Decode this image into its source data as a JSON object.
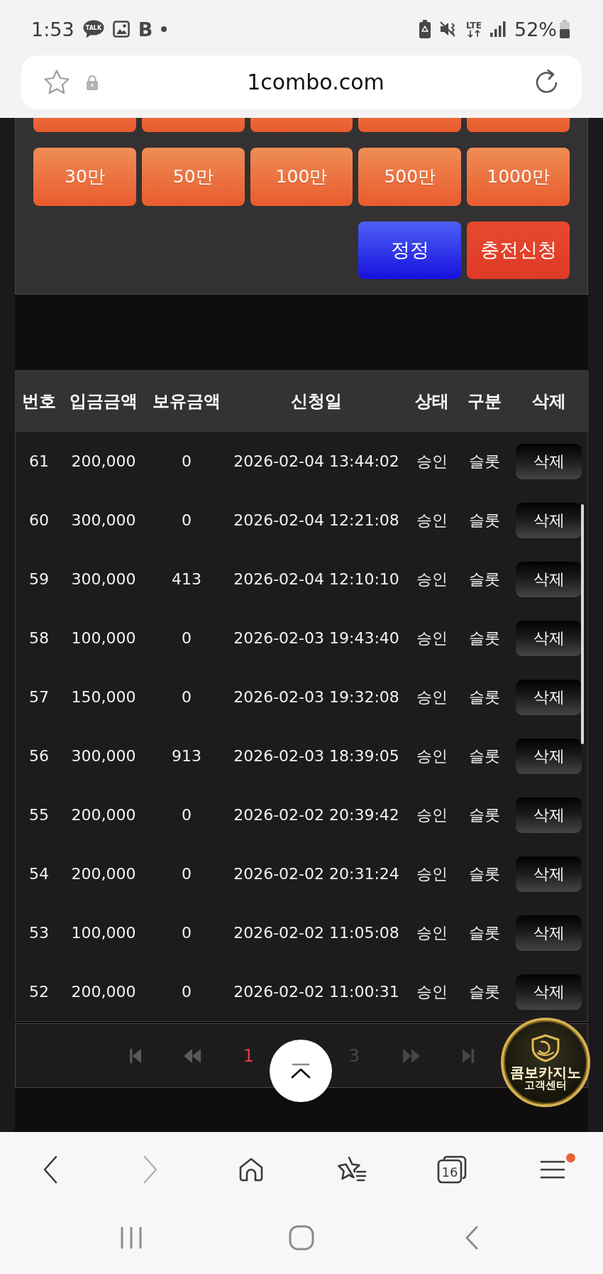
{
  "status_bar": {
    "time": "1:53",
    "notifications": [
      {
        "kind": "talk",
        "label": "TALK"
      },
      {
        "kind": "image"
      },
      {
        "kind": "letter",
        "label": "B"
      },
      {
        "kind": "dot"
      }
    ],
    "network": "LTE",
    "battery": "52%"
  },
  "address_bar": {
    "url": "1combo.com"
  },
  "amount_rows": [
    {
      "buttons": [
        {
          "clipped": true
        },
        {
          "clipped": true
        },
        {
          "clipped": true
        },
        {
          "clipped": true
        },
        {
          "clipped": true
        }
      ]
    },
    {
      "buttons": [
        {
          "label": "30만",
          "clipped": false
        },
        {
          "label": "50만",
          "clipped": false
        },
        {
          "label": "100만",
          "clipped": false
        },
        {
          "label": "500만",
          "clipped": false
        },
        {
          "label": "1000만",
          "clipped": false
        }
      ]
    }
  ],
  "actions": [
    {
      "kind": "correct",
      "label": "정정"
    },
    {
      "kind": "submit",
      "label": "충전신청"
    }
  ],
  "table": {
    "columns": [
      "번호",
      "입금금액",
      "보유금액",
      "신청일",
      "상태",
      "구분",
      "삭제"
    ],
    "rows": [
      {
        "number": "61",
        "deposit": "200,000",
        "balance": "0",
        "requested_at": "2026-02-04 13:44:02",
        "status": "승인",
        "category": "슬롯",
        "delete_label": "삭제"
      },
      {
        "number": "60",
        "deposit": "300,000",
        "balance": "0",
        "requested_at": "2026-02-04 12:21:08",
        "status": "승인",
        "category": "슬롯",
        "delete_label": "삭제"
      },
      {
        "number": "59",
        "deposit": "300,000",
        "balance": "413",
        "requested_at": "2026-02-04 12:10:10",
        "status": "승인",
        "category": "슬롯",
        "delete_label": "삭제"
      },
      {
        "number": "58",
        "deposit": "100,000",
        "balance": "0",
        "requested_at": "2026-02-03 19:43:40",
        "status": "승인",
        "category": "슬롯",
        "delete_label": "삭제"
      },
      {
        "number": "57",
        "deposit": "150,000",
        "balance": "0",
        "requested_at": "2026-02-03 19:32:08",
        "status": "승인",
        "category": "슬롯",
        "delete_label": "삭제"
      },
      {
        "number": "56",
        "deposit": "300,000",
        "balance": "913",
        "requested_at": "2026-02-03 18:39:05",
        "status": "승인",
        "category": "슬롯",
        "delete_label": "삭제"
      },
      {
        "number": "55",
        "deposit": "200,000",
        "balance": "0",
        "requested_at": "2026-02-02 20:39:42",
        "status": "승인",
        "category": "슬롯",
        "delete_label": "삭제"
      },
      {
        "number": "54",
        "deposit": "200,000",
        "balance": "0",
        "requested_at": "2026-02-02 20:31:24",
        "status": "승인",
        "category": "슬롯",
        "delete_label": "삭제"
      },
      {
        "number": "53",
        "deposit": "100,000",
        "balance": "0",
        "requested_at": "2026-02-02 11:05:08",
        "status": "승인",
        "category": "슬롯",
        "delete_label": "삭제"
      },
      {
        "number": "52",
        "deposit": "200,000",
        "balance": "0",
        "requested_at": "2026-02-02 11:00:31",
        "status": "승인",
        "category": "슬롯",
        "delete_label": "삭제"
      }
    ]
  },
  "pagination": [
    {
      "kind": "first"
    },
    {
      "kind": "prev"
    },
    {
      "kind": "page",
      "label": "1",
      "selected": true
    },
    {
      "kind": "page",
      "label": "3",
      "selected": false
    },
    {
      "kind": "next"
    },
    {
      "kind": "last"
    }
  ],
  "support_badge": {
    "title": "콤보카지노",
    "subtitle": "고객센터"
  },
  "browser_nav": [
    {
      "kind": "back",
      "disabled": false,
      "badge": false
    },
    {
      "kind": "forward",
      "disabled": true,
      "badge": false
    },
    {
      "kind": "home",
      "disabled": false,
      "badge": false
    },
    {
      "kind": "bookmarks",
      "disabled": false,
      "badge": false
    },
    {
      "kind": "tabs",
      "label": "16",
      "disabled": false,
      "badge": false
    },
    {
      "kind": "menu",
      "disabled": false,
      "badge": true
    }
  ],
  "system_nav": [
    {
      "kind": "recents"
    },
    {
      "kind": "home"
    },
    {
      "kind": "back"
    }
  ]
}
